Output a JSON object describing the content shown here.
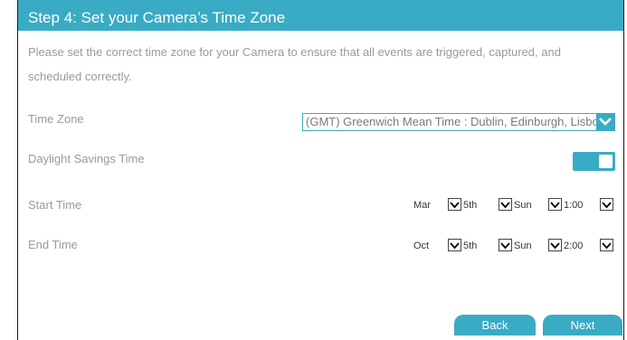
{
  "header": {
    "title": "Step 4: Set your Camera’s Time Zone"
  },
  "intro": {
    "text": "Please set the correct time zone for your Camera to ensure that all events are triggered, captured, and scheduled correctly."
  },
  "time_zone": {
    "label": "Time Zone",
    "value": "(GMT) Greenwich Mean Time : Dublin, Edinburgh, Lisbon, London"
  },
  "dst": {
    "label": "Daylight Savings Time",
    "enabled": true
  },
  "start_time": {
    "label": "Start Time",
    "month": "Mar",
    "week": "5th",
    "day": "Sun",
    "time": "1:00"
  },
  "end_time": {
    "label": "End Time",
    "month": "Oct",
    "week": "5th",
    "day": "Sun",
    "time": "2:00"
  },
  "buttons": {
    "back": "Back",
    "next": "Next"
  },
  "colors": {
    "accent": "#3aabc4"
  }
}
